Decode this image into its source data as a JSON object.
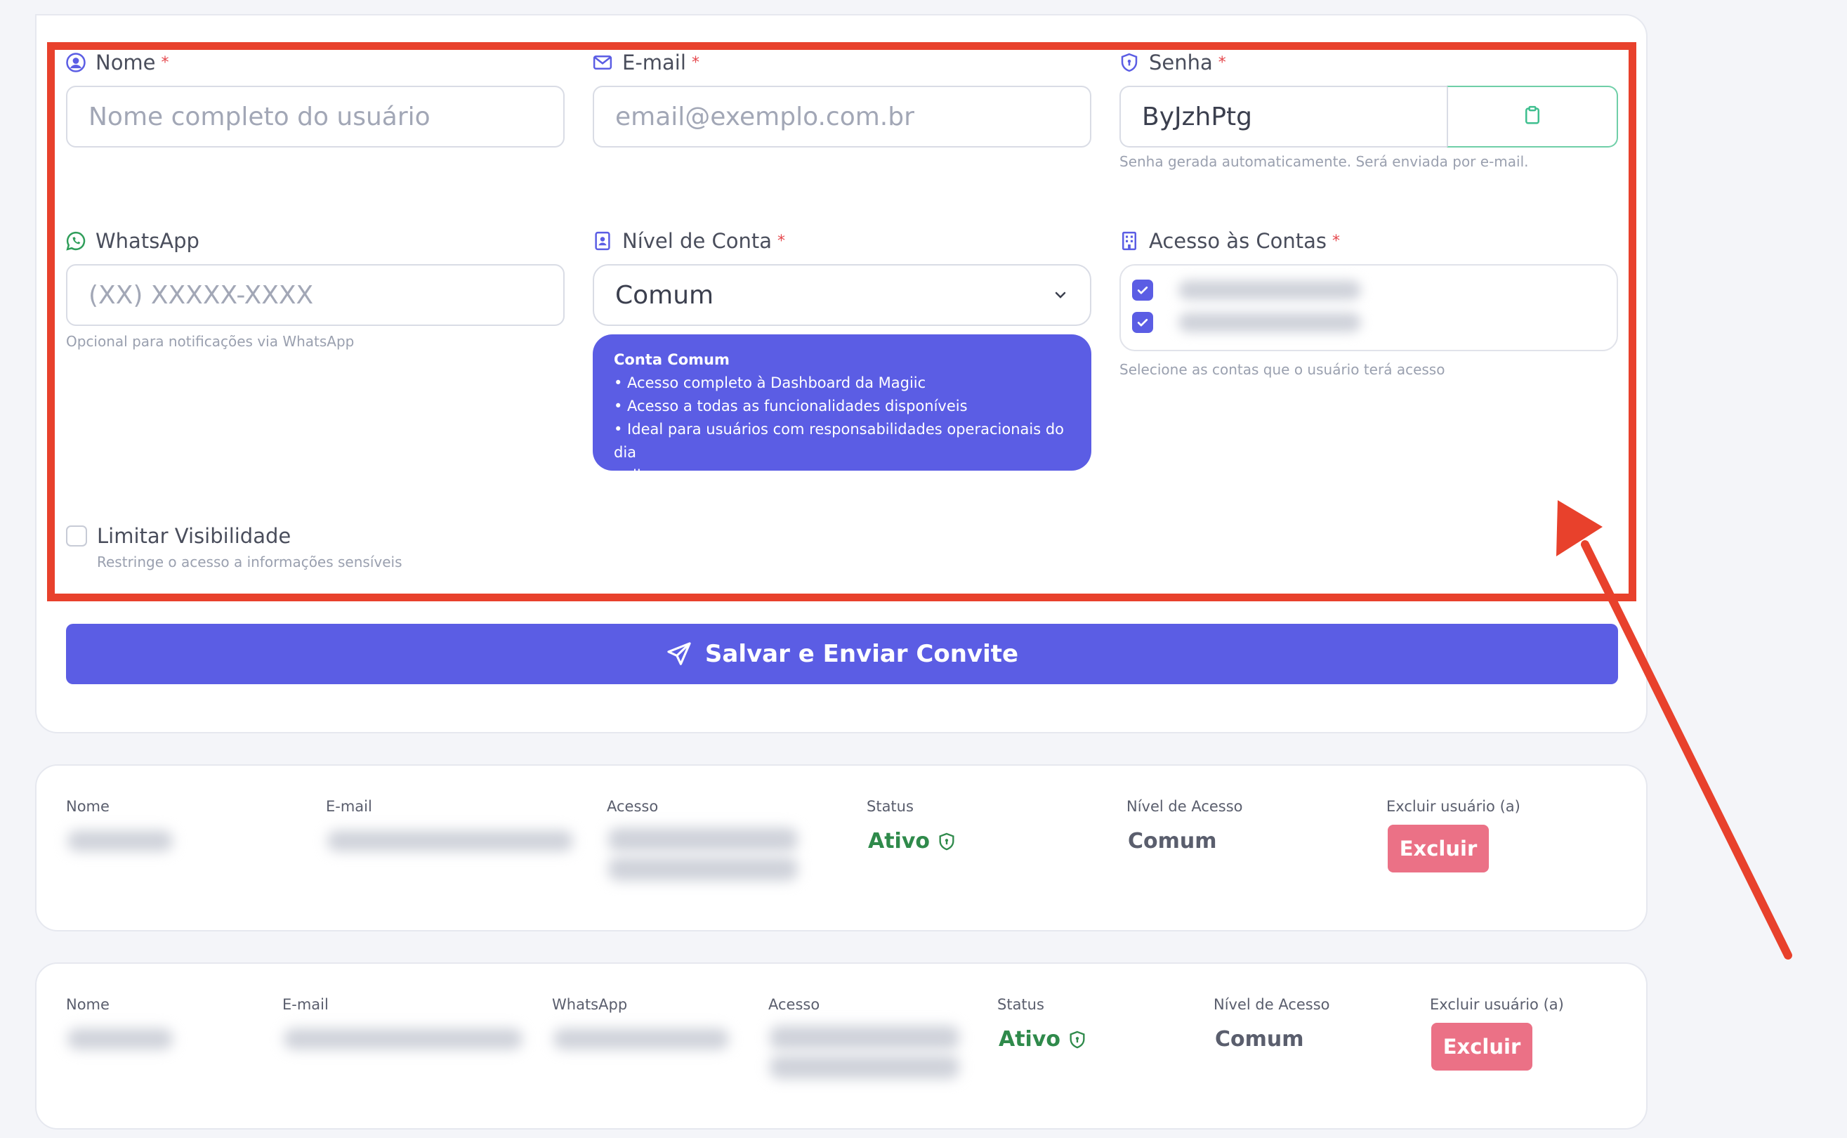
{
  "form": {
    "name": {
      "label": "Nome",
      "required": "*",
      "placeholder": "Nome completo do usuário"
    },
    "email": {
      "label": "E-mail",
      "required": "*",
      "placeholder": "email@exemplo.com.br"
    },
    "password": {
      "label": "Senha",
      "required": "*",
      "value": "ByJzhPtg",
      "hint": "Senha gerada automaticamente. Será enviada por e-mail."
    },
    "whatsapp": {
      "label": "WhatsApp",
      "placeholder": "(XX) XXXXX-XXXX",
      "hint": "Opcional para notificações via WhatsApp"
    },
    "account_level": {
      "label": "Nível de Conta",
      "required": "*",
      "selected": "Comum",
      "info_title": "Conta Comum",
      "info_lines": [
        "• Acesso completo à Dashboard da Magiic",
        "• Acesso a todas as funcionalidades disponíveis",
        "• Ideal para usuários com responsabilidades operacionais do dia",
        "a dia"
      ]
    },
    "accounts_access": {
      "label": "Acesso às Contas",
      "required": "*",
      "hint": "Selecione as contas que o usuário terá acesso"
    },
    "limit_visibility": {
      "label": "Limitar Visibilidade",
      "hint": "Restringe o acesso a informações sensíveis"
    },
    "submit_label": "Salvar e Enviar Convite"
  },
  "users": [
    {
      "headers": {
        "name": "Nome",
        "email": "E-mail",
        "access": "Acesso",
        "status": "Status",
        "level": "Nível de Acesso",
        "delete": "Excluir usuário (a)"
      },
      "status": "Ativo",
      "level": "Comum",
      "delete_label": "Excluir"
    },
    {
      "headers": {
        "name": "Nome",
        "email": "E-mail",
        "whatsapp": "WhatsApp",
        "access": "Acesso",
        "status": "Status",
        "level": "Nível de Acesso",
        "delete": "Excluir usuário (a)"
      },
      "status": "Ativo",
      "level": "Comum",
      "delete_label": "Excluir"
    }
  ],
  "colors": {
    "accent": "#5b5de4",
    "danger": "#eb7186",
    "success": "#2f8a4b",
    "annotation": "#e8412c"
  },
  "icons": [
    "user-circle-icon",
    "envelope-icon",
    "shield-icon",
    "whatsapp-icon",
    "id-badge-icon",
    "building-icon",
    "clipboard-icon",
    "chevron-down-icon",
    "check-icon",
    "send-icon",
    "shield-check-icon"
  ]
}
